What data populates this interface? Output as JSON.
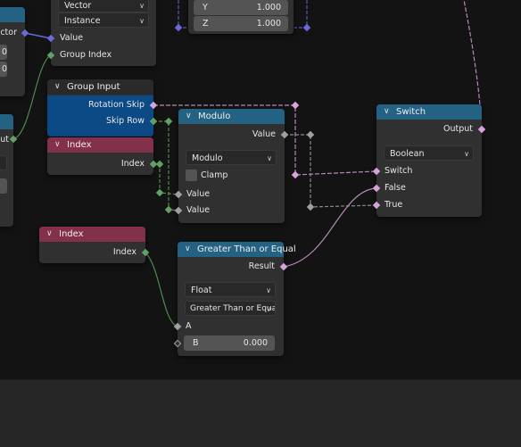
{
  "nodes": {
    "combine_xyz_partial": {
      "rows": [
        {
          "label": "Y",
          "value": "1.000"
        },
        {
          "label": "Z",
          "value": "1.000"
        }
      ]
    },
    "sample_node_partial": {
      "dropdowns": [
        "Vector",
        "Instance"
      ],
      "inputs": [
        "Value",
        "Group Index"
      ]
    },
    "left_vector_node_partial": {
      "output_label": "ector",
      "fields": [
        "0",
        "0"
      ]
    },
    "left_lower_node_partial": {
      "output_label": "ut"
    },
    "group_input": {
      "title": "Group Input",
      "outputs": [
        "Rotation Skip",
        "Skip Row"
      ]
    },
    "index_top": {
      "title": "Index",
      "output": "Index"
    },
    "index_bottom": {
      "title": "Index",
      "output": "Index"
    },
    "modulo": {
      "title": "Modulo",
      "output": "Value",
      "operation": "Modulo",
      "clamp_label": "Clamp",
      "clamp_checked": false,
      "inputs": [
        "Value",
        "Value"
      ]
    },
    "switch": {
      "title": "Switch",
      "output": "Output",
      "type": "Boolean",
      "inputs": [
        "Switch",
        "False",
        "True"
      ]
    },
    "compare": {
      "title": "Greater Than or Equal",
      "output": "Result",
      "data_type": "Float",
      "operation": "Greater Than or Equal",
      "input_a": "A",
      "input_b_label": "B",
      "input_b_value": "0.000"
    }
  },
  "colors": {
    "header_math": "#246283",
    "header_input": "#83314a",
    "socket_int": "#63a063",
    "socket_bool": "#d8a2dc",
    "socket_float": "#a0a0a0",
    "socket_vector": "#6a6ad8"
  }
}
